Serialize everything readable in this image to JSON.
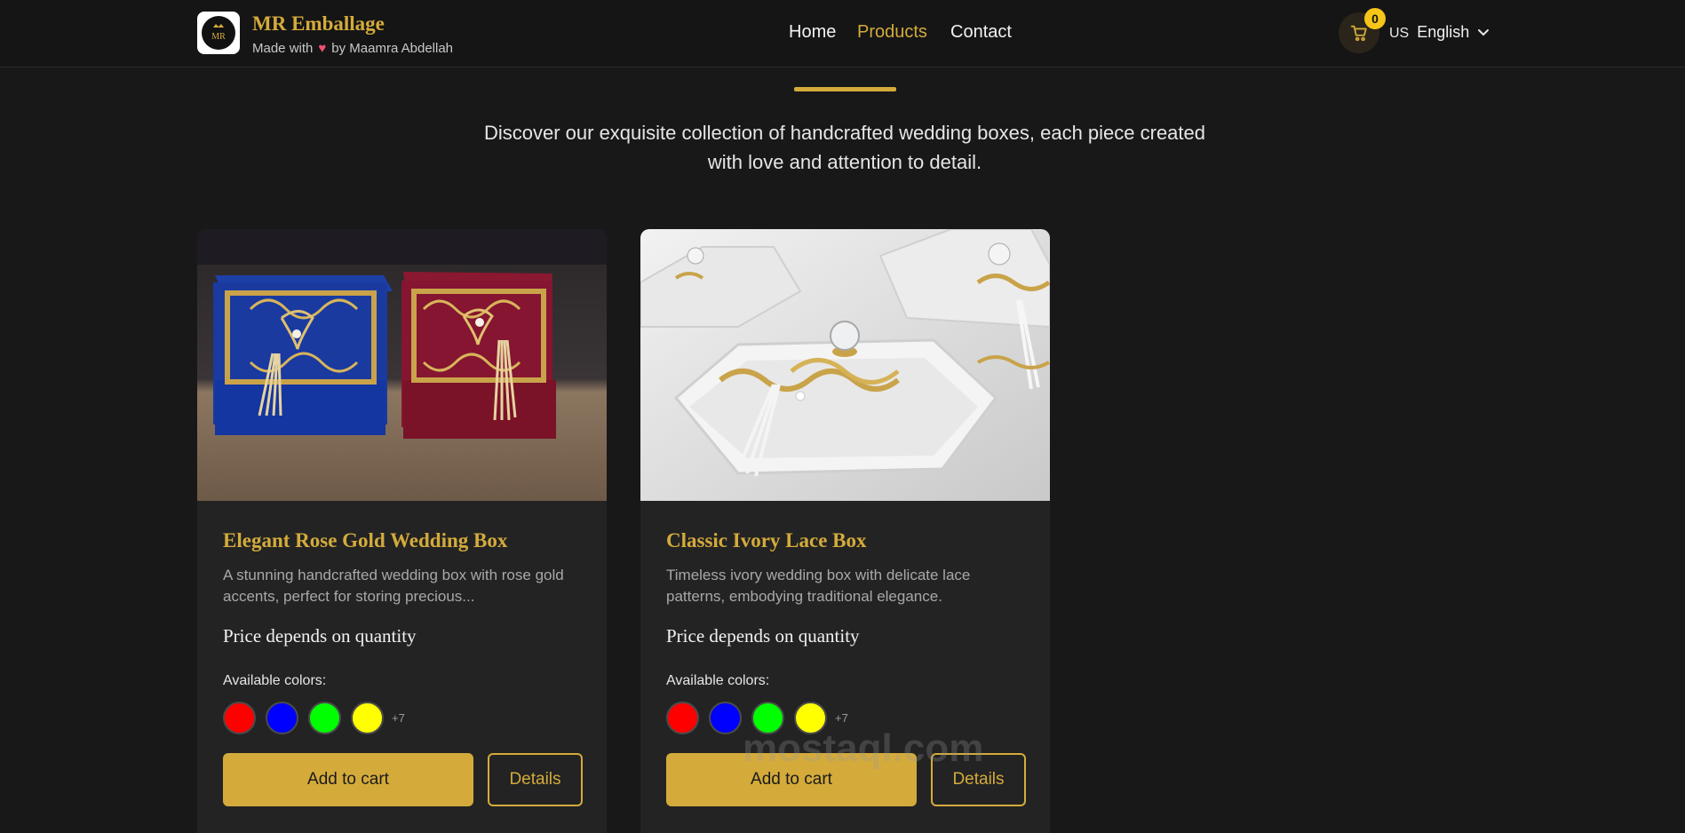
{
  "header": {
    "brand_title": "MR Emballage",
    "brand_sub_prefix": "Made with",
    "brand_sub_suffix": "by Maamra Abdellah",
    "logo_text": "MR",
    "nav": {
      "home": "Home",
      "products": "Products",
      "contact": "Contact"
    },
    "cart_count": "0",
    "lang_code": "US",
    "lang_label": "English"
  },
  "intro": {
    "text": "Discover our exquisite collection of handcrafted wedding boxes, each piece created with love and attention to detail."
  },
  "products": [
    {
      "title": "Elegant Rose Gold Wedding Box",
      "description": "A stunning handcrafted wedding box with rose gold accents, perfect for storing precious...",
      "price": "Price depends on quantity",
      "colors_label": "Available colors:",
      "colors": [
        "#ff0000",
        "#0000ff",
        "#00ff00",
        "#ffff00"
      ],
      "more_colors": "+7",
      "add_to_cart": "Add to cart",
      "details": "Details"
    },
    {
      "title": "Classic Ivory Lace Box",
      "description": "Timeless ivory wedding box with delicate lace patterns, embodying traditional elegance.",
      "price": "Price depends on quantity",
      "colors_label": "Available colors:",
      "colors": [
        "#ff0000",
        "#0000ff",
        "#00ff00",
        "#ffff00"
      ],
      "more_colors": "+7",
      "add_to_cart": "Add to cart",
      "details": "Details"
    }
  ],
  "accent_color": "#d4ab3b",
  "watermark": "mostaql.com"
}
